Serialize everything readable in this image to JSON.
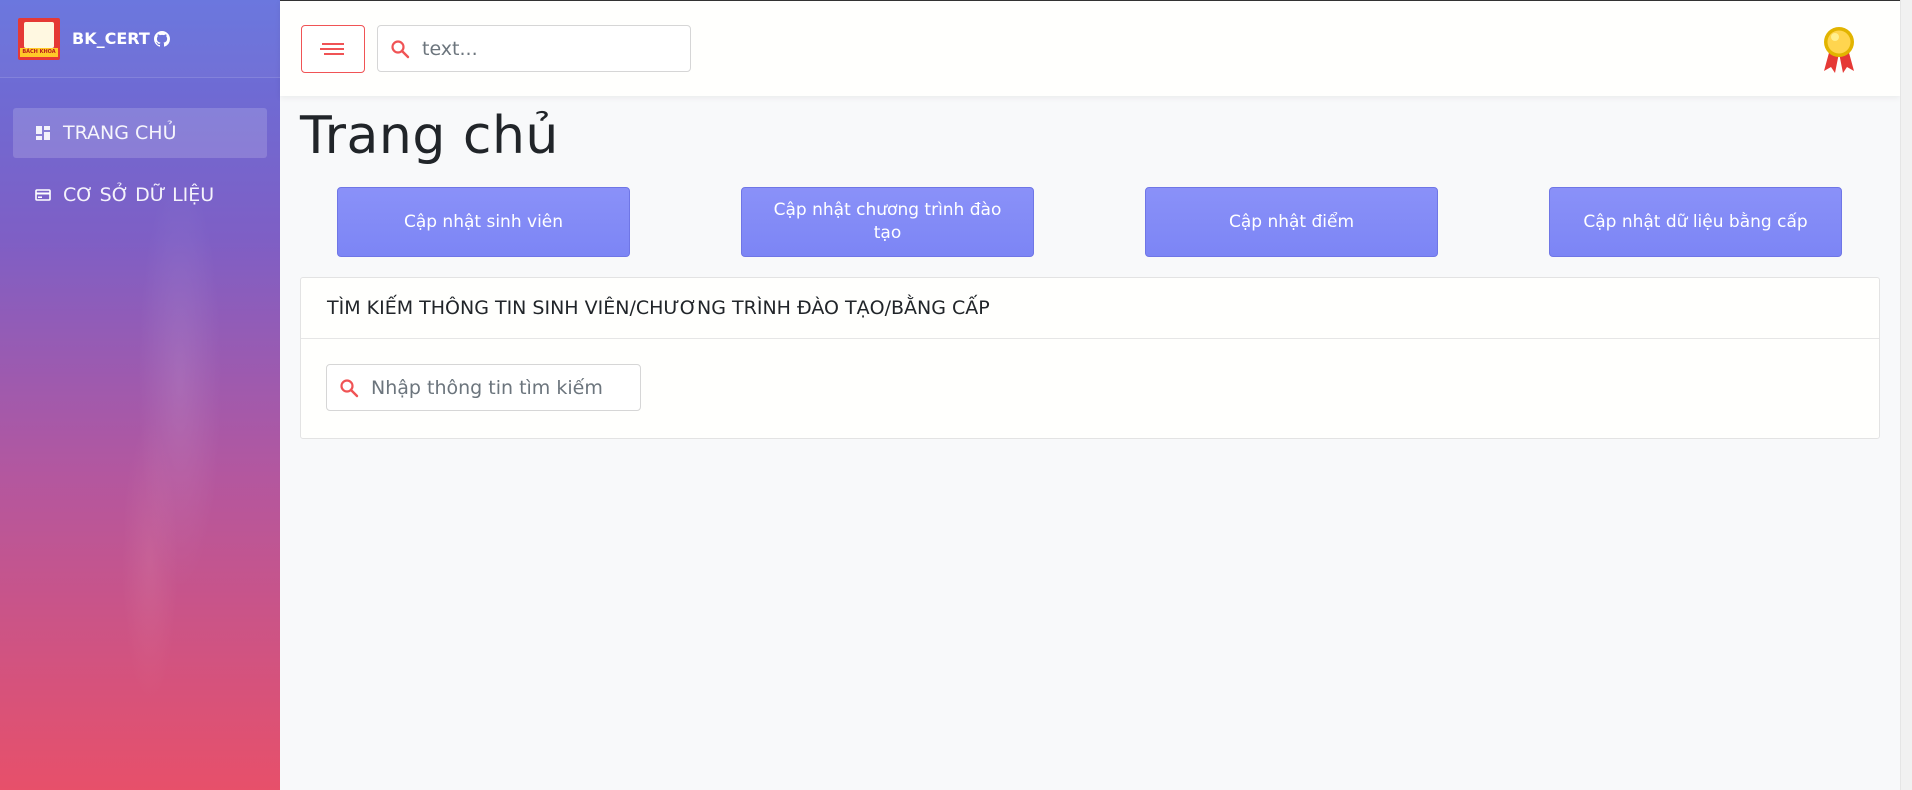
{
  "brand": {
    "name": "BK_CERT",
    "logo_text": "BÁCH KHOA"
  },
  "sidebar": {
    "items": [
      {
        "label": "TRANG CHỦ",
        "icon": "dashboard-icon",
        "active": true
      },
      {
        "label": "CƠ SỞ DỮ LIỆU",
        "icon": "database-icon",
        "active": false
      }
    ]
  },
  "topbar": {
    "search_placeholder": "text..."
  },
  "main": {
    "title": "Trang chủ",
    "actions": [
      "Cập nhật sinh viên",
      "Cập nhật chương trình đào tạo",
      "Cập nhật điểm",
      "Cập nhật dữ liệu bằng cấp"
    ],
    "search_card": {
      "header": "TÌM KIẾM THÔNG TIN SINH VIÊN/CHƯƠNG TRÌNH ĐÀO TẠO/BẰNG CẤP",
      "placeholder": "Nhập thông tin tìm kiếm"
    }
  },
  "colors": {
    "accent": "#f05355",
    "button": "#7c85f5",
    "sidebar_top": "#6572dd",
    "sidebar_bottom": "#e7506a"
  }
}
